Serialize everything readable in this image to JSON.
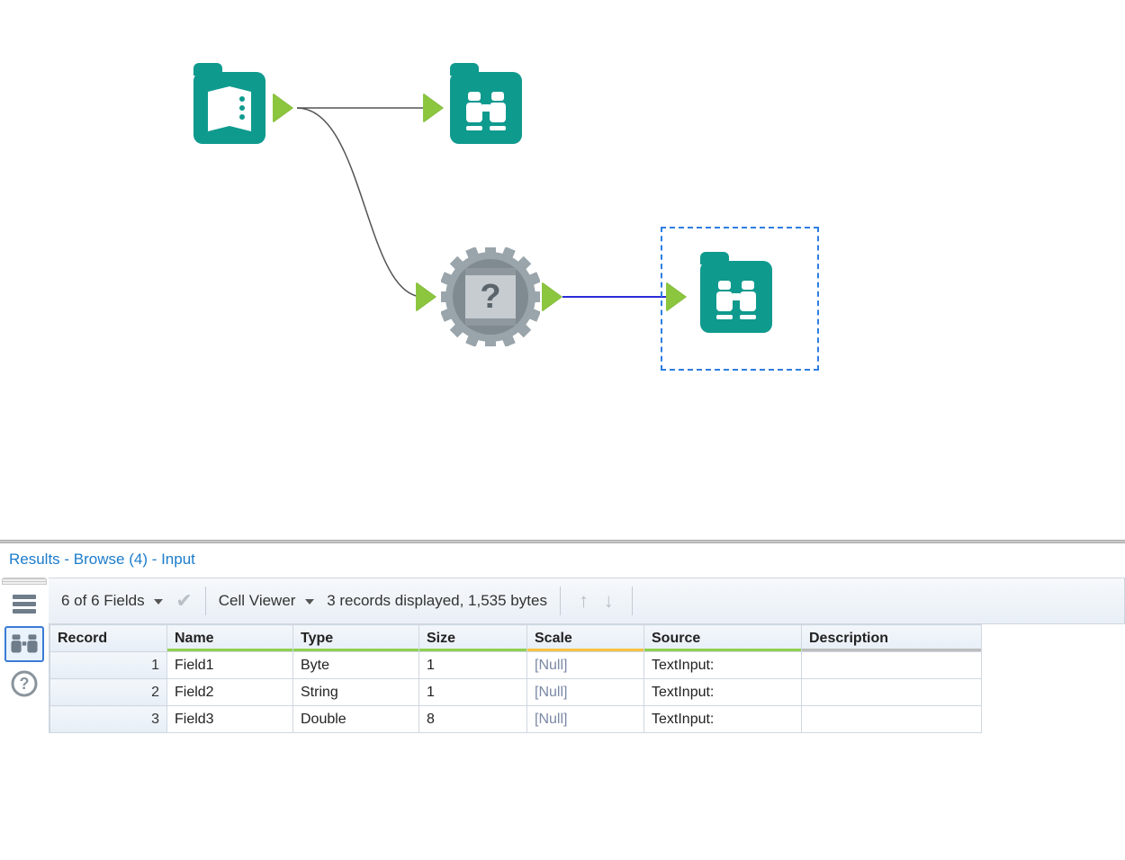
{
  "workflow": {
    "nodes": {
      "text_input": {
        "name": "text-input-tool",
        "icon": "book"
      },
      "browse_top": {
        "name": "browse-tool-top",
        "icon": "binoculars"
      },
      "unknown": {
        "name": "unknown-tool",
        "icon": "question-gear"
      },
      "browse_sel": {
        "name": "browse-tool-selected",
        "icon": "binoculars",
        "selected": true
      }
    }
  },
  "results": {
    "title": "Results - Browse (4) - Input",
    "fields_dropdown": "6 of 6 Fields",
    "cell_viewer_label": "Cell Viewer",
    "records_summary": "3 records displayed, 1,535 bytes",
    "columns": [
      {
        "key": "record",
        "label": "Record",
        "underbar": ""
      },
      {
        "key": "name",
        "label": "Name",
        "underbar": "green"
      },
      {
        "key": "type",
        "label": "Type",
        "underbar": "green"
      },
      {
        "key": "size",
        "label": "Size",
        "underbar": "green"
      },
      {
        "key": "scale",
        "label": "Scale",
        "underbar": "yellow"
      },
      {
        "key": "source",
        "label": "Source",
        "underbar": "green"
      },
      {
        "key": "description",
        "label": "Description",
        "underbar": "gray"
      }
    ],
    "rows": [
      {
        "record": "1",
        "name": "Field1",
        "type": "Byte",
        "size": "1",
        "scale": "[Null]",
        "source": "TextInput:",
        "description": ""
      },
      {
        "record": "2",
        "name": "Field2",
        "type": "String",
        "size": "1",
        "scale": "[Null]",
        "source": "TextInput:",
        "description": ""
      },
      {
        "record": "3",
        "name": "Field3",
        "type": "Double",
        "size": "8",
        "scale": "[Null]",
        "source": "TextInput:",
        "description": ""
      }
    ],
    "vstrip": {
      "rows_icon": "rows-view-icon",
      "metadata_icon": "metadata-view-icon",
      "help_icon": "help-icon"
    }
  }
}
